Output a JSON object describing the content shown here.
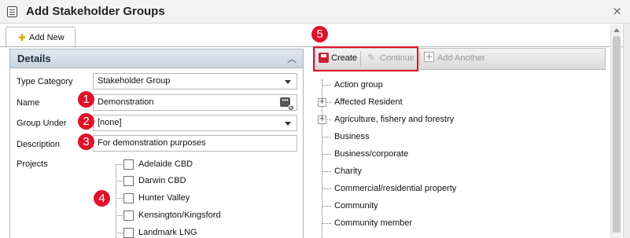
{
  "window": {
    "title": "Add Stakeholder Groups",
    "close_glyph": "×"
  },
  "tab": {
    "label": "Add New"
  },
  "details": {
    "header": "Details",
    "type_category": {
      "label": "Type Category",
      "value": "Stakeholder Group"
    },
    "name": {
      "label": "Name",
      "value": "Demonstration"
    },
    "group_under": {
      "label": "Group Under",
      "value": "[none]"
    },
    "description": {
      "label": "Description",
      "value": "For demonstration purposes"
    },
    "projects": {
      "label": "Projects",
      "items": [
        "Adelaide CBD",
        "Darwin CBD",
        "Hunter Valley",
        "Kensington/Kingsford",
        "Landmark LNG"
      ]
    }
  },
  "toolbar": {
    "create": "Create",
    "continue": "Continue",
    "add_another": "Add Another"
  },
  "tree": {
    "items": [
      "Action group",
      "Affected Resident",
      "Agriculture, fishery and forestry",
      "Business",
      "Business/corporate",
      "Charity",
      "Commercial/residential property",
      "Community",
      "Community member"
    ]
  },
  "annotations": [
    "1",
    "2",
    "3",
    "4",
    "5"
  ],
  "colors": {
    "annotation": "#e2112a",
    "header_bg": "#c9d5e2"
  }
}
